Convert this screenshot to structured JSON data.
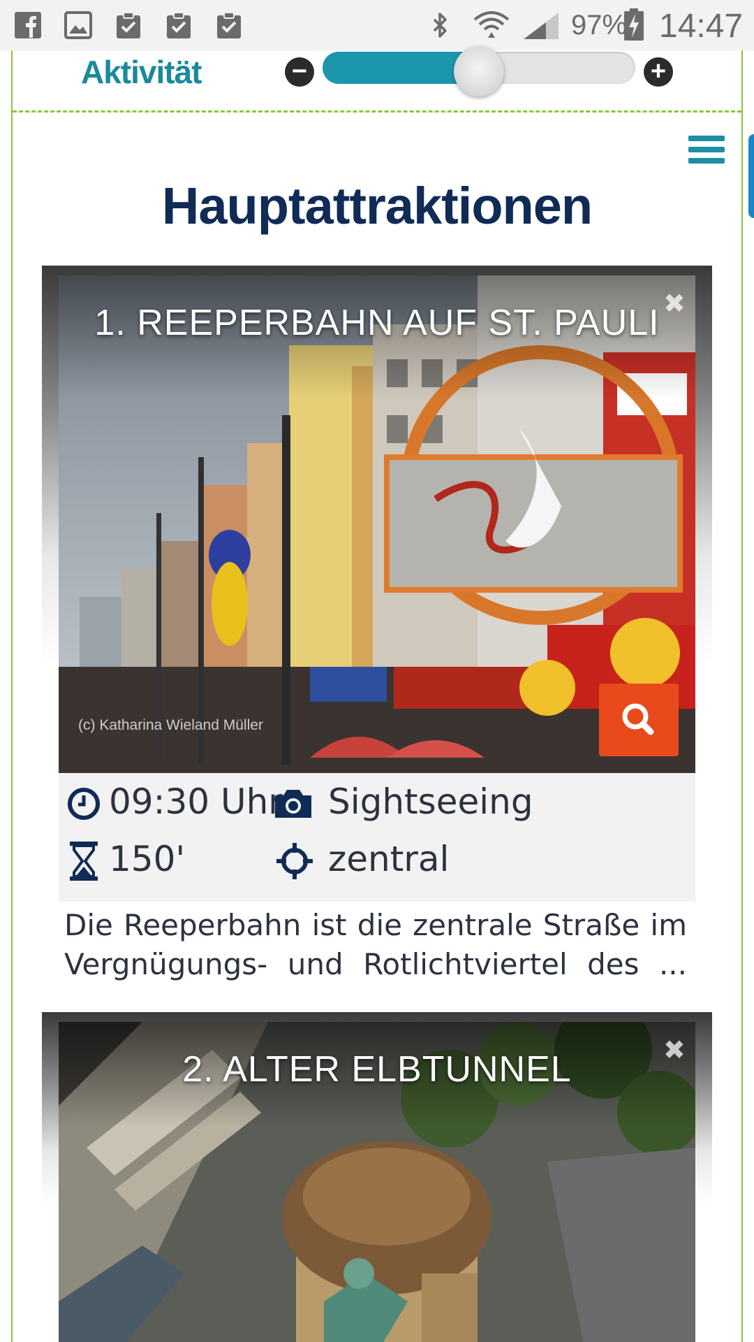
{
  "status_bar": {
    "left_icons": [
      "facebook-icon",
      "image-icon",
      "clipboard-check-icon",
      "clipboard-check-icon",
      "clipboard-check-icon"
    ],
    "right_icons": [
      "bluetooth-icon",
      "wifi-icon",
      "signal-icon",
      "battery-charging-icon"
    ],
    "battery_percent": "97%",
    "time": "14:47"
  },
  "activity": {
    "label": "Aktivität",
    "level": 0.5,
    "minus_symbol": "−",
    "plus_symbol": "+"
  },
  "page": {
    "title": "Hauptattraktionen"
  },
  "attractions": [
    {
      "title": "1. REEPERBAHN AUF ST. PAULI",
      "close_symbol": "✖",
      "photo_credit": "(c) Katharina Wieland Müller",
      "time": "09:30 Uhr",
      "category": "Sightseeing",
      "duration": "150'",
      "location": "zentral",
      "description": "Die Reeperbahn ist die zentrale Straße im Vergnügungs- und Rotlichtviertel des ..."
    },
    {
      "title": "2. ALTER ELBTUNNEL",
      "close_symbol": "✖"
    }
  ],
  "colors": {
    "accent_green": "#8cc63f",
    "accent_teal": "#1b96ad",
    "title_navy": "#0f2b56",
    "zoom_orange": "#e84a1c"
  }
}
